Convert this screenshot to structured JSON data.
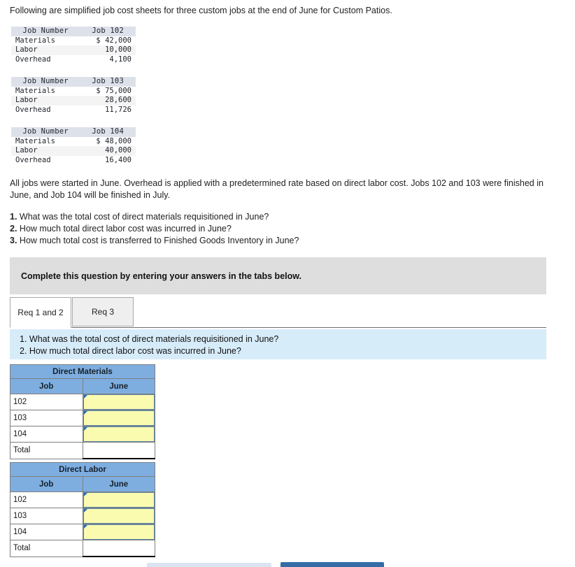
{
  "intro": {
    "text": "Following are simplified job cost sheets for three custom jobs at the end of June for Custom Patios."
  },
  "job_sheets": [
    {
      "header_label": "Job Number",
      "header_value": "Job 102",
      "rows": [
        {
          "label": "Materials",
          "value": "$ 42,000"
        },
        {
          "label": "Labor",
          "value": "10,000"
        },
        {
          "label": "Overhead",
          "value": "4,100"
        }
      ]
    },
    {
      "header_label": "Job Number",
      "header_value": "Job 103",
      "rows": [
        {
          "label": "Materials",
          "value": "$ 75,000"
        },
        {
          "label": "Labor",
          "value": "28,600"
        },
        {
          "label": "Overhead",
          "value": "11,726"
        }
      ]
    },
    {
      "header_label": "Job Number",
      "header_value": "Job 104",
      "rows": [
        {
          "label": "Materials",
          "value": "$ 48,000"
        },
        {
          "label": "Labor",
          "value": "40,000"
        },
        {
          "label": "Overhead",
          "value": "16,400"
        }
      ]
    }
  ],
  "body_paragraph": "All jobs were started in June. Overhead is applied with a predetermined rate based on direct labor cost. Jobs 102 and 103 were finished in June, and Job 104 will be finished in July.",
  "questions": [
    {
      "num": "1.",
      "text": "What was the total cost of direct materials requisitioned in June?"
    },
    {
      "num": "2.",
      "text": "How much total direct labor cost was incurred in June?"
    },
    {
      "num": "3.",
      "text": "How much total cost is transferred to Finished Goods Inventory in June?"
    }
  ],
  "banner": {
    "text": "Complete this question by entering your answers in the tabs below."
  },
  "tabs": [
    {
      "label": "Req 1 and 2",
      "active": true
    },
    {
      "label": "Req 3",
      "active": false
    }
  ],
  "question_box": {
    "line1": "1. What was the total cost of direct materials requisitioned in June?",
    "line2": "2. How much total direct labor cost was incurred in June?"
  },
  "answer_tables": [
    {
      "title": "Direct Materials",
      "columns": [
        "Job",
        "June"
      ],
      "rows": [
        {
          "job": "102",
          "value": "",
          "input": true
        },
        {
          "job": "103",
          "value": "",
          "input": true
        },
        {
          "job": "104",
          "value": "",
          "input": true
        },
        {
          "job": "Total",
          "value": "",
          "input": false
        }
      ]
    },
    {
      "title": "Direct Labor",
      "columns": [
        "Job",
        "June"
      ],
      "rows": [
        {
          "job": "102",
          "value": "",
          "input": true
        },
        {
          "job": "103",
          "value": "",
          "input": true
        },
        {
          "job": "104",
          "value": "",
          "input": true
        },
        {
          "job": "Total",
          "value": "",
          "input": false
        }
      ]
    }
  ],
  "footer_buttons": [
    {
      "name": "previous-button",
      "color": "#dbe5f1"
    },
    {
      "name": "next-button",
      "color": "#336ca6"
    }
  ],
  "colors": {
    "header_blue": "#7eaee0",
    "input_yellow": "#fbfbb0",
    "question_blue": "#d7ecf9",
    "banner_gray": "#dedede",
    "sheet_header": "#dde1ea"
  }
}
